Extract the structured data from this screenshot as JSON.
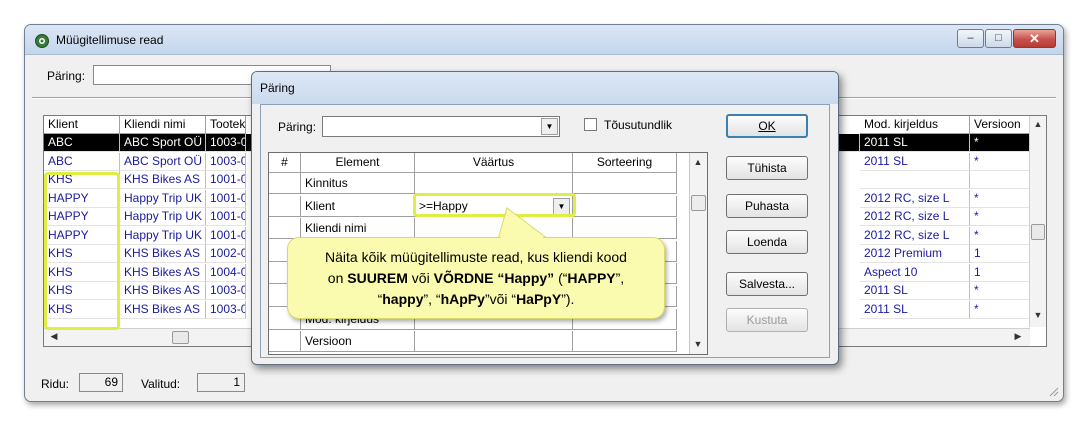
{
  "window": {
    "title": "Müügitellimuse read",
    "paring_label": "Päring:",
    "paring_value": "",
    "buttons": {
      "minimize": "–",
      "maximize": "□",
      "close": "✕"
    }
  },
  "grid": {
    "columns": [
      "Klient",
      "Kliendi nimi",
      "Tootek",
      "Mod. kirjeldus",
      "Versioon"
    ],
    "rows": [
      {
        "klient": "ABC",
        "nimi": "ABC Sport OÜ",
        "toode": "1003-0",
        "mod": "2011 SL",
        "ver": "*",
        "selected": true
      },
      {
        "klient": "ABC",
        "nimi": "ABC Sport OÜ",
        "toode": "1003-0",
        "mod": "2011 SL",
        "ver": "*",
        "selected": false
      },
      {
        "klient": "KHS",
        "nimi": "KHS Bikes AS",
        "toode": "1001-0",
        "mod": "",
        "ver": "",
        "selected": false
      },
      {
        "klient": "HAPPY",
        "nimi": "Happy Trip UK",
        "toode": "1001-0",
        "mod": "2012 RC, size L",
        "ver": "*",
        "selected": false
      },
      {
        "klient": "HAPPY",
        "nimi": "Happy Trip UK",
        "toode": "1001-0",
        "mod": "2012 RC, size L",
        "ver": "*",
        "selected": false
      },
      {
        "klient": "HAPPY",
        "nimi": "Happy Trip UK",
        "toode": "1001-0",
        "mod": "2012 RC, size L",
        "ver": "*",
        "selected": false
      },
      {
        "klient": "KHS",
        "nimi": "KHS Bikes AS",
        "toode": "1002-0",
        "mod": "2012 Premium",
        "ver": "1",
        "selected": false
      },
      {
        "klient": "KHS",
        "nimi": "KHS Bikes AS",
        "toode": "1004-0",
        "mod": "Aspect 10",
        "ver": "1",
        "selected": false
      },
      {
        "klient": "KHS",
        "nimi": "KHS Bikes AS",
        "toode": "1003-0",
        "mod": "2011 SL",
        "ver": "*",
        "selected": false
      },
      {
        "klient": "KHS",
        "nimi": "KHS Bikes AS",
        "toode": "1003-0",
        "mod": "2011 SL",
        "ver": "*",
        "selected": false
      }
    ]
  },
  "status": {
    "ridu_label": "Ridu:",
    "ridu_value": "69",
    "valitud_label": "Valitud:",
    "valitud_value": "1"
  },
  "dialog": {
    "title": "Päring",
    "paring_label": "Päring:",
    "paring_value": "",
    "ascending_label": "Tõusutundlik",
    "columns": [
      "#",
      "Element",
      "Väärtus",
      "Sorteering"
    ],
    "rows": [
      {
        "num": "",
        "element": "Kinnitus",
        "value": "",
        "sort": ""
      },
      {
        "num": "",
        "element": "Klient",
        "value": ">=Happy",
        "sort": ""
      },
      {
        "num": "",
        "element": "Kliendi nimi",
        "value": "",
        "sort": ""
      },
      {
        "num": "",
        "element": "",
        "value": "",
        "sort": ""
      },
      {
        "num": "",
        "element": "",
        "value": "",
        "sort": ""
      },
      {
        "num": "",
        "element": "",
        "value": "",
        "sort": ""
      },
      {
        "num": "",
        "element": "Mod. kirjeldus",
        "value": "",
        "sort": ""
      },
      {
        "num": "",
        "element": "Versioon",
        "value": "",
        "sort": ""
      }
    ],
    "buttons": {
      "ok": "OK",
      "cancel": "Tühista",
      "clear": "Puhasta",
      "list": "Loenda",
      "save": "Salvesta...",
      "delete": "Kustuta"
    }
  },
  "callout": {
    "line1": "Näita kõik müügitellimuste read, kus kliendi kood",
    "line2_pre": "on ",
    "line2_b1": "SUUREM",
    "line2_mid": " või ",
    "line2_b2": "VÕRDNE “Happy”",
    "line2_post1": " (“",
    "line2_b3": "HAPPY",
    "line2_post2": "”,",
    "line3_pre": "“",
    "line3_b1": "happy",
    "line3_mid1": "”, “",
    "line3_b2": "hApPy",
    "line3_mid2": "”või “",
    "line3_b3": "HaPpY",
    "line3_post": "”)."
  },
  "colors": {
    "highlight": "#dfee45",
    "callout_bg": "#fbfbb0",
    "grid_text": "#1a1aa0",
    "selected_bg": "#000000"
  }
}
